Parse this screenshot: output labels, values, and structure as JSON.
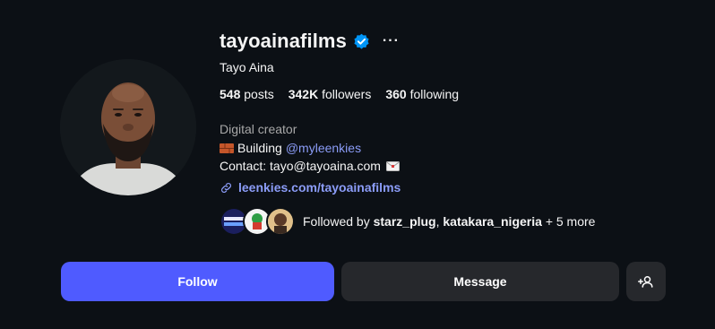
{
  "profile": {
    "username": "tayoainafilms",
    "full_name": "Tayo Aina",
    "more_label": "···",
    "stats": {
      "posts_count": "548",
      "posts_label": "posts",
      "followers_count": "342K",
      "followers_label": "followers",
      "following_count": "360",
      "following_label": "following"
    },
    "category": "Digital creator",
    "bio": {
      "line1_prefix": "Building",
      "line1_mention": "@myleenkies",
      "line2": "Contact: tayo@tayoaina.com"
    },
    "link": "leenkies.com/tayoainafilms",
    "followed_by": {
      "prefix": "Followed by",
      "user1": "starz_plug",
      "separator": ",",
      "user2": "katakara_nigeria",
      "suffix": "+ 5 more"
    }
  },
  "actions": {
    "follow_label": "Follow",
    "message_label": "Message"
  },
  "icons": {
    "verified": "verified-badge-icon",
    "more": "more-options-icon",
    "brick": "brick-emoji-icon",
    "mail": "envelope-emoji-icon",
    "link": "link-icon",
    "add_user": "add-user-icon"
  },
  "colors": {
    "background": "#0c1015",
    "accent": "#4f5bff",
    "link": "#8b9cf7",
    "secondary_button": "#26282c",
    "verified": "#0095f6"
  }
}
